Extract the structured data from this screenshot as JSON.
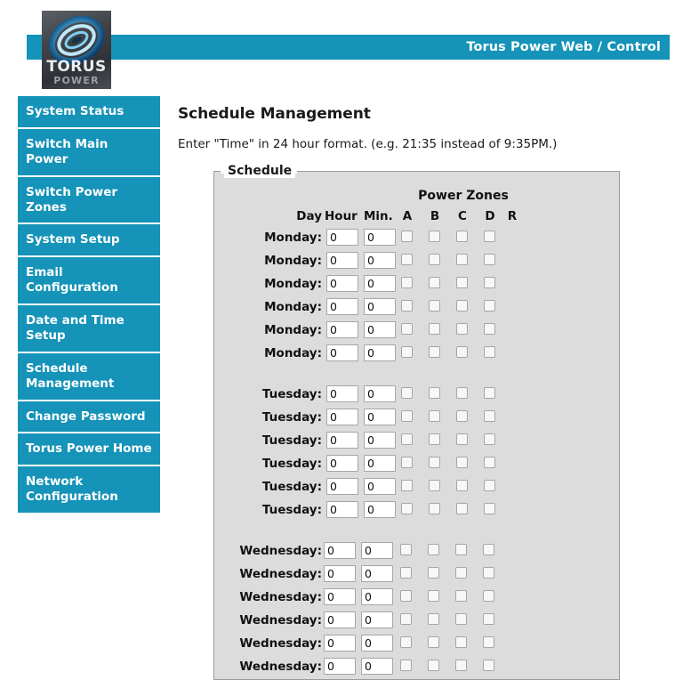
{
  "header": {
    "title": "Torus Power Web / Control",
    "bar_color": "#1593b8"
  },
  "logo": {
    "line1": "TORUS",
    "line2": "POWER",
    "icon": "torus-swirl-icon"
  },
  "sidebar": {
    "items": [
      {
        "label": "System Status"
      },
      {
        "label": "Switch Main Power"
      },
      {
        "label": "Switch Power Zones"
      },
      {
        "label": "System Setup"
      },
      {
        "label": "Email Configuration"
      },
      {
        "label": "Date and Time Setup"
      },
      {
        "label": "Schedule Management"
      },
      {
        "label": "Change Password"
      },
      {
        "label": "Torus Power Home"
      },
      {
        "label": "Network Configuration"
      }
    ]
  },
  "main": {
    "page_title": "Schedule Management",
    "instruction": "Enter \"Time\" in 24 hour format. (e.g. 21:35 instead of 9:35PM.)"
  },
  "schedule": {
    "legend": "Schedule",
    "zones_header": "Power Zones",
    "columns": {
      "day": "Day",
      "hour": "Hour",
      "min": "Min.",
      "zone_a": "A",
      "zone_b": "B",
      "zone_c": "C",
      "zone_d": "D",
      "zone_r": "R"
    },
    "groups": [
      {
        "day": "Monday:",
        "rows": [
          {
            "hour": "0",
            "min": "0",
            "a": false,
            "b": false,
            "c": false,
            "d": false
          },
          {
            "hour": "0",
            "min": "0",
            "a": false,
            "b": false,
            "c": false,
            "d": false
          },
          {
            "hour": "0",
            "min": "0",
            "a": false,
            "b": false,
            "c": false,
            "d": false
          },
          {
            "hour": "0",
            "min": "0",
            "a": false,
            "b": false,
            "c": false,
            "d": false
          },
          {
            "hour": "0",
            "min": "0",
            "a": false,
            "b": false,
            "c": false,
            "d": false
          },
          {
            "hour": "0",
            "min": "0",
            "a": false,
            "b": false,
            "c": false,
            "d": false
          }
        ]
      },
      {
        "day": "Tuesday:",
        "rows": [
          {
            "hour": "0",
            "min": "0",
            "a": false,
            "b": false,
            "c": false,
            "d": false
          },
          {
            "hour": "0",
            "min": "0",
            "a": false,
            "b": false,
            "c": false,
            "d": false
          },
          {
            "hour": "0",
            "min": "0",
            "a": false,
            "b": false,
            "c": false,
            "d": false
          },
          {
            "hour": "0",
            "min": "0",
            "a": false,
            "b": false,
            "c": false,
            "d": false
          },
          {
            "hour": "0",
            "min": "0",
            "a": false,
            "b": false,
            "c": false,
            "d": false
          },
          {
            "hour": "0",
            "min": "0",
            "a": false,
            "b": false,
            "c": false,
            "d": false
          }
        ]
      },
      {
        "day": "Wednesday:",
        "rows": [
          {
            "hour": "0",
            "min": "0",
            "a": false,
            "b": false,
            "c": false,
            "d": false
          },
          {
            "hour": "0",
            "min": "0",
            "a": false,
            "b": false,
            "c": false,
            "d": false
          },
          {
            "hour": "0",
            "min": "0",
            "a": false,
            "b": false,
            "c": false,
            "d": false
          },
          {
            "hour": "0",
            "min": "0",
            "a": false,
            "b": false,
            "c": false,
            "d": false
          },
          {
            "hour": "0",
            "min": "0",
            "a": false,
            "b": false,
            "c": false,
            "d": false
          },
          {
            "hour": "0",
            "min": "0",
            "a": false,
            "b": false,
            "c": false,
            "d": false
          }
        ]
      }
    ]
  }
}
